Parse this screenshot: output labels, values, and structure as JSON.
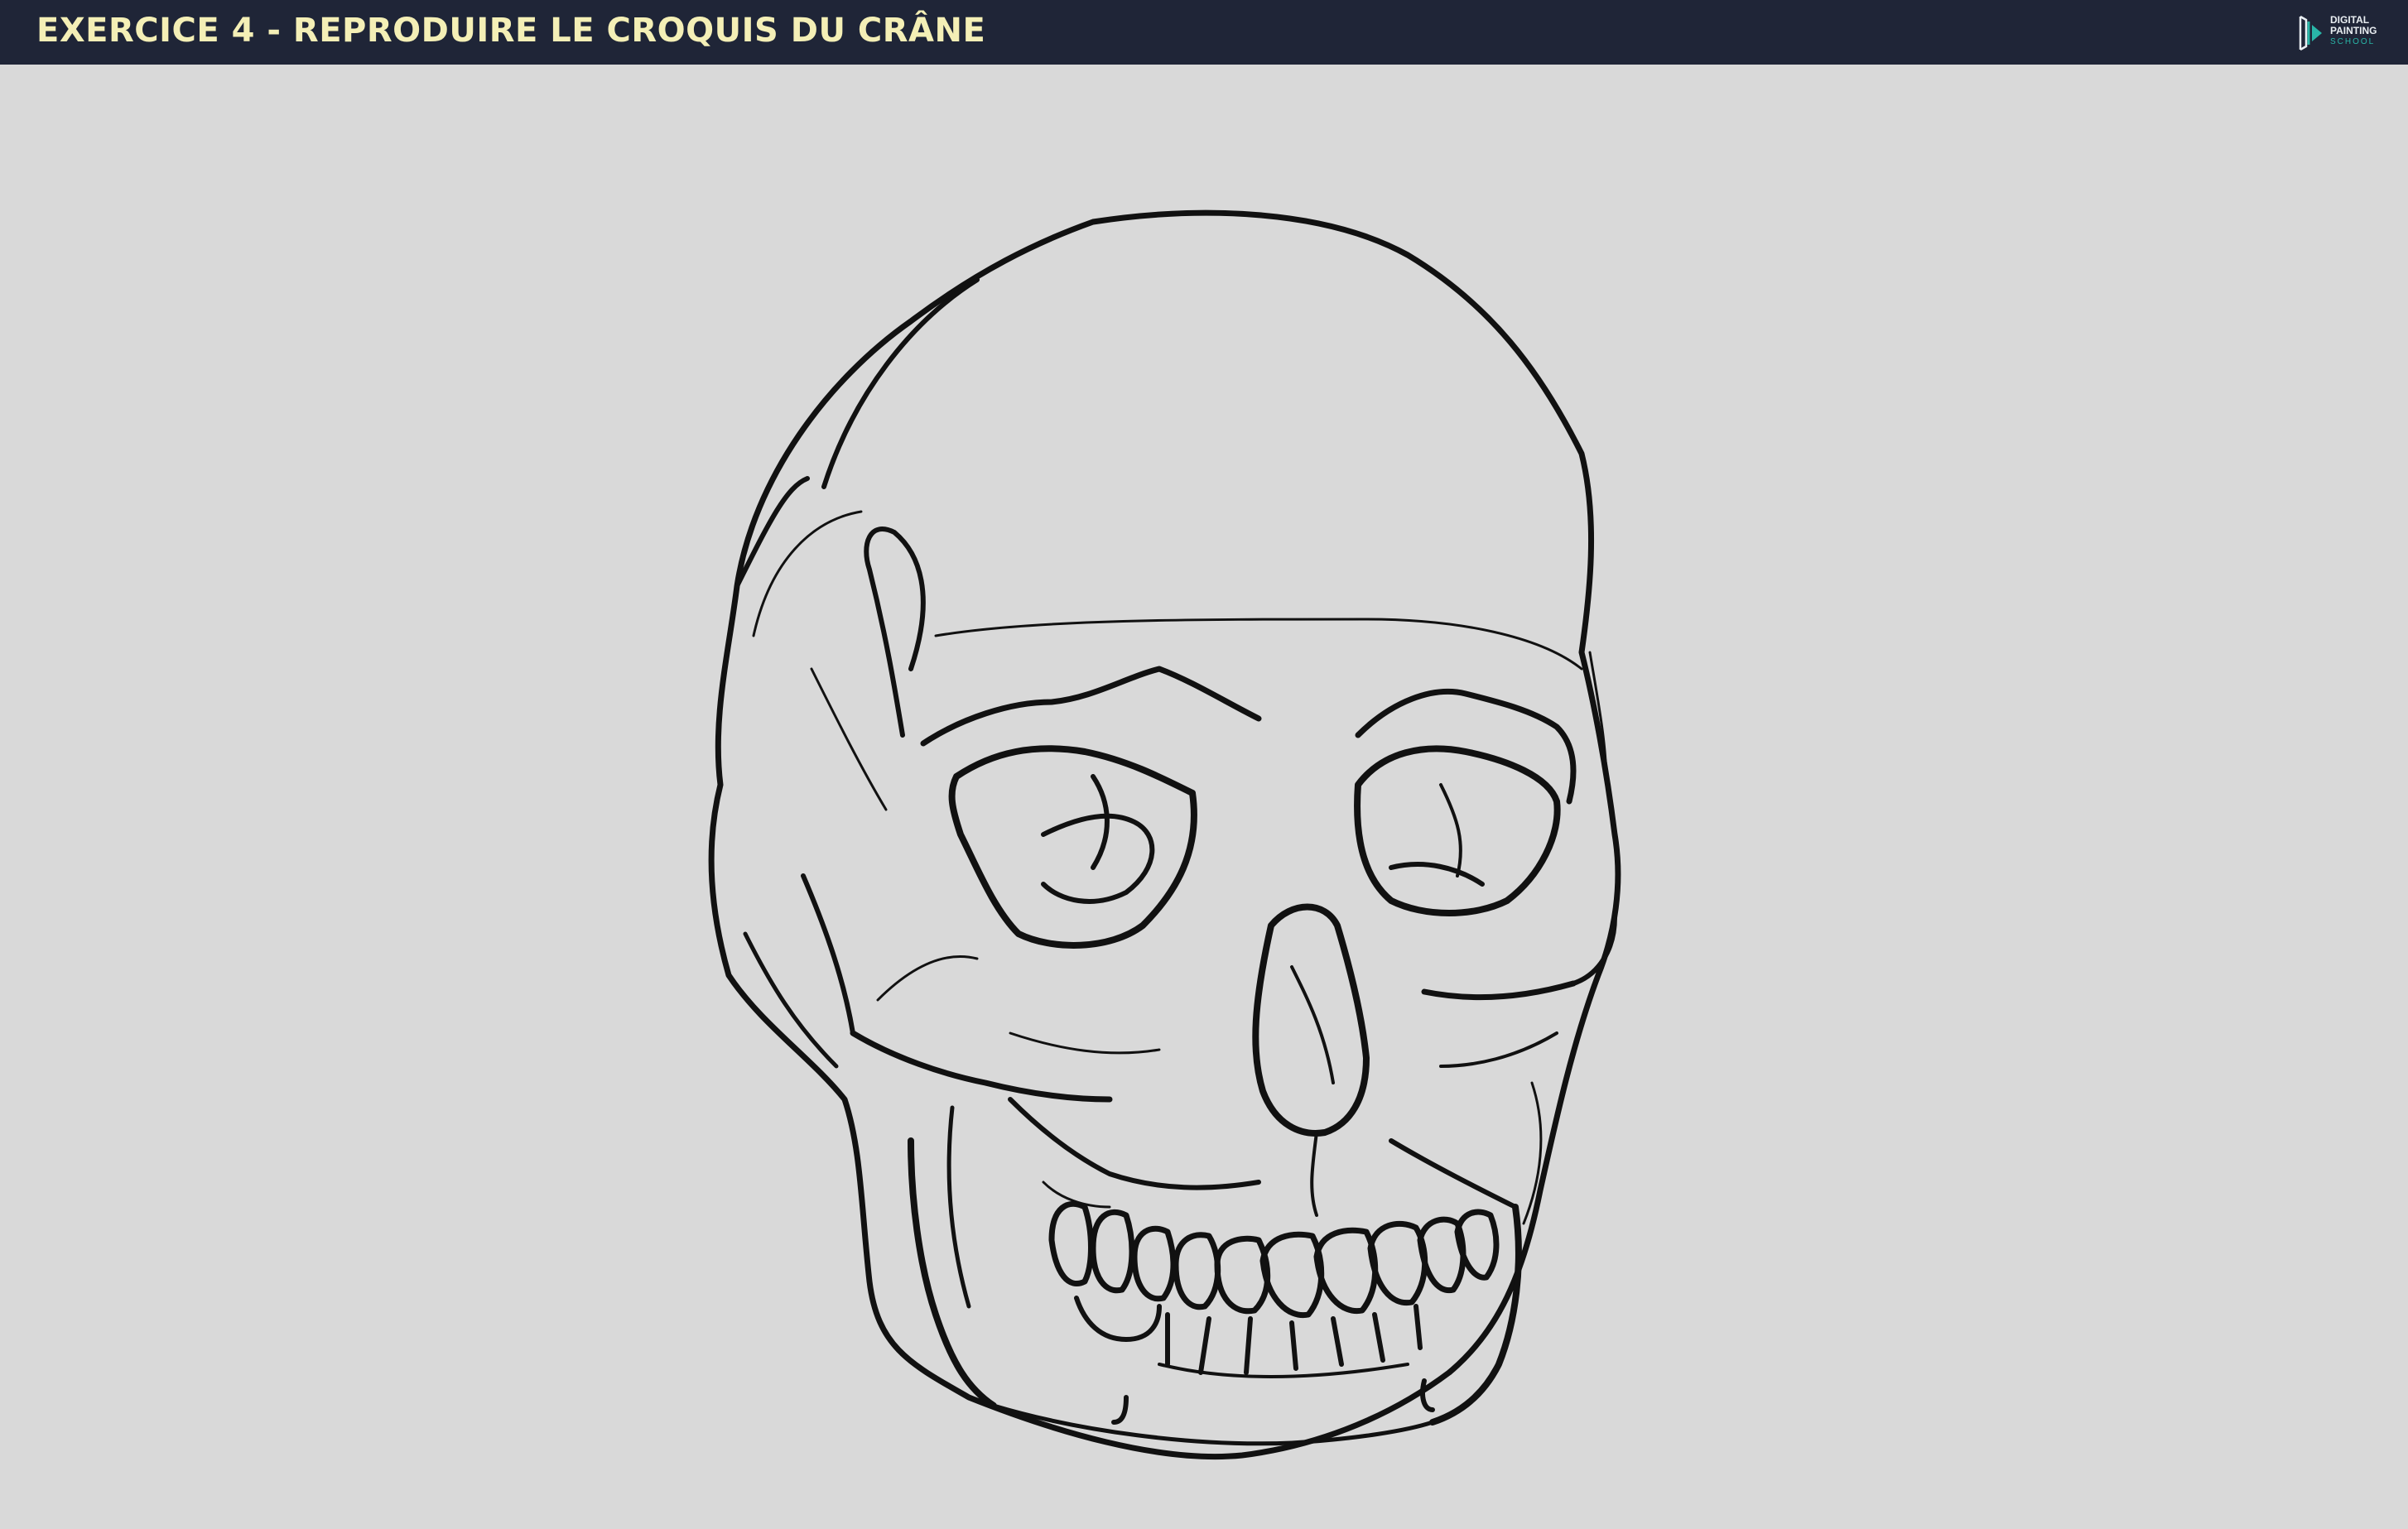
{
  "header": {
    "title": "EXERCICE 4 - REPRODUIRE LE CROQUIS DU CRÂNE",
    "background": "#1f2537",
    "title_color": "#f4efb6"
  },
  "logo": {
    "line1": "DIGITAL",
    "line2": "PAINTING",
    "line3": "SCHOOL",
    "accent": "#29b6a8"
  },
  "canvas": {
    "background": "#d9d9d9",
    "illustration": "skull-line-drawing"
  }
}
